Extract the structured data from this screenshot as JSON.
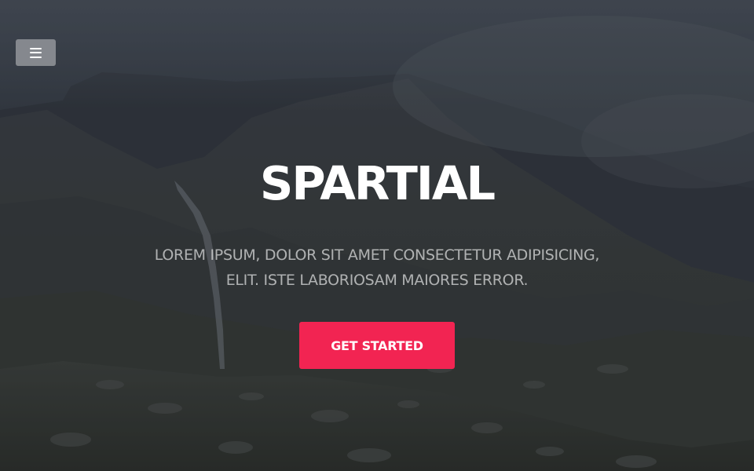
{
  "nav": {
    "menu_icon": "hamburger-menu-icon"
  },
  "hero": {
    "title": "SPARTIAL",
    "subtitle_line1": "LOREM IPSUM, DOLOR SIT AMET CONSECTETUR ADIPISICING,",
    "subtitle_line2": "ELIT. ISTE LABORIOSAM MAIORES ERROR.",
    "cta_label": "GET STARTED"
  },
  "colors": {
    "accent": "#f22452",
    "text": "#ffffff",
    "menu_button": "#96999e"
  }
}
